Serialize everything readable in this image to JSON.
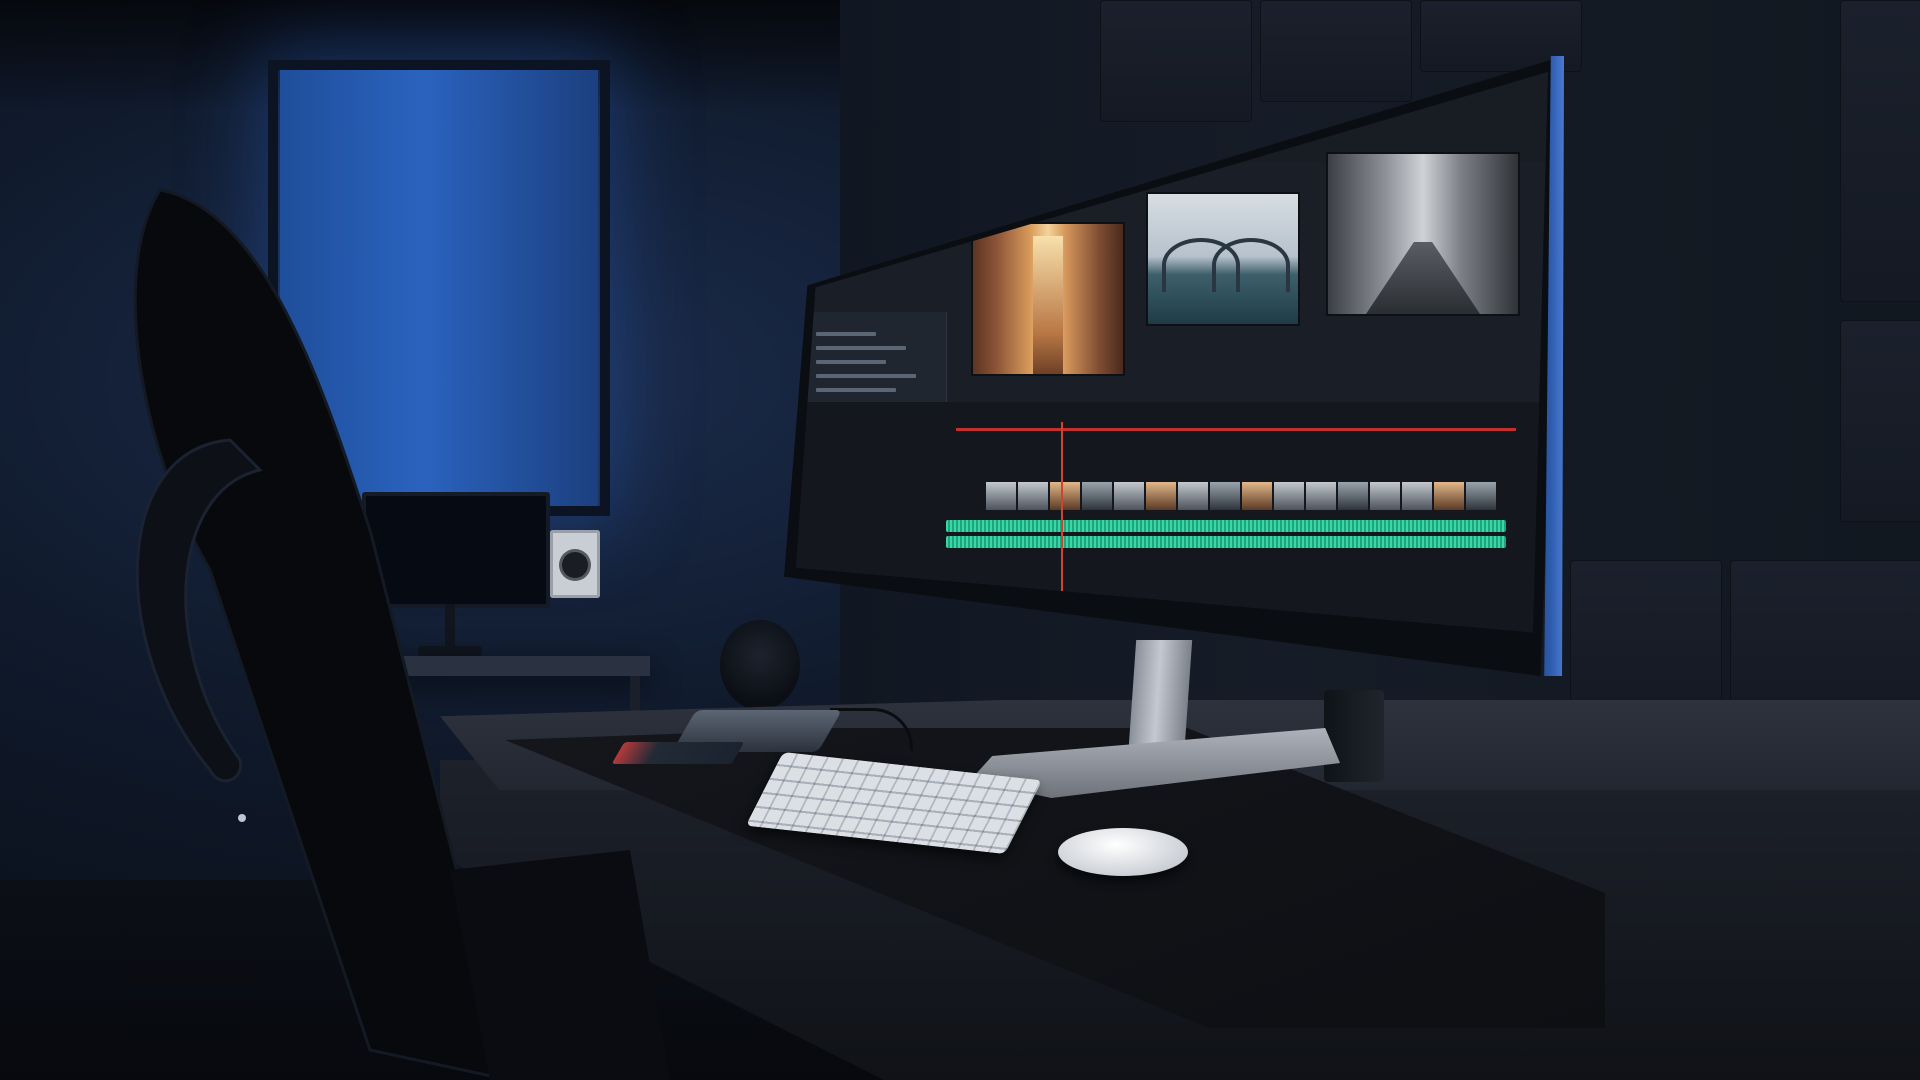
{
  "scene": {
    "title": "",
    "subjects": [
      "monitor-video-editor",
      "keyboard",
      "mouse",
      "desk",
      "office-chair",
      "window",
      "back-monitor",
      "speakers"
    ]
  },
  "colors": {
    "window_light": "#2a63bf",
    "accent_timeline_red": "#c4302b",
    "audio_track_green": "#39d6a6",
    "wall": "#161c27",
    "desk": "#2d323d"
  }
}
